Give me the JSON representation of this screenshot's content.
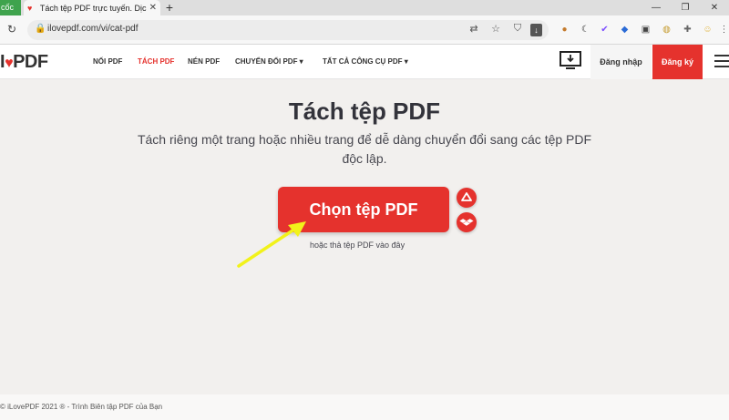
{
  "browser": {
    "tab_group": "cốc",
    "tab_title": "Tách tệp PDF trực tuyến. Dịch",
    "new_tab": "+",
    "url": "ilovepdf.com/vi/cat-pdf",
    "window_controls": [
      "—",
      "❐",
      "✕"
    ]
  },
  "site": {
    "logo": {
      "left": "I",
      "right": "PDF"
    },
    "nav": [
      {
        "label": "NỐI PDF",
        "active": false
      },
      {
        "label": "TÁCH PDF",
        "active": true
      },
      {
        "label": "NÉN PDF",
        "active": false
      },
      {
        "label": "CHUYỂN ĐỔI PDF ▾",
        "active": false
      },
      {
        "label": "TẤT CẢ CÔNG CỤ PDF ▾",
        "active": false
      }
    ],
    "login": "Đăng nhập",
    "signup": "Đăng ký"
  },
  "main": {
    "title": "Tách tệp PDF",
    "subtitle": "Tách riêng một trang hoặc nhiều trang để dễ dàng chuyển đổi sang các tệp PDF độc lập.",
    "upload_button": "Chọn tệp PDF",
    "hint": "hoặc thả tệp PDF vào đây"
  },
  "footer": {
    "text": "© iLovePDF 2021 ® - Trình Biên tập PDF của Bạn"
  },
  "colors": {
    "brand_red": "#e5322d",
    "annotation_arrow": "#f2f21a"
  }
}
